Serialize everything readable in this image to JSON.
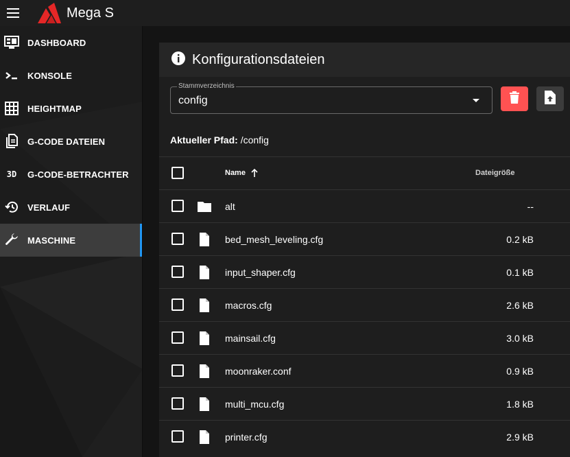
{
  "app": {
    "title": "Mega S"
  },
  "sidebar": {
    "items": [
      {
        "label": "DASHBOARD",
        "icon": "monitor-dashboard-icon",
        "active": false
      },
      {
        "label": "KONSOLE",
        "icon": "console-icon",
        "active": false
      },
      {
        "label": "HEIGHTMAP",
        "icon": "grid-icon",
        "active": false
      },
      {
        "label": "G-CODE DATEIEN",
        "icon": "file-document-multiple-icon",
        "active": false
      },
      {
        "label": "G-CODE-BETRACHTER",
        "icon": "3d-icon",
        "active": false
      },
      {
        "label": "VERLAUF",
        "icon": "history-icon",
        "active": false
      },
      {
        "label": "MASCHINE",
        "icon": "wrench-icon",
        "active": true
      }
    ],
    "icon_3d_text": "3D"
  },
  "main": {
    "title": "Konfigurationsdateien",
    "root_select": {
      "label": "Stammverzeichnis",
      "value": "config"
    },
    "path": {
      "label": "Aktueller Pfad:",
      "value": "/config"
    },
    "table": {
      "headers": {
        "name": "Name",
        "size": "Dateigröße"
      },
      "rows": [
        {
          "name": "alt",
          "type": "folder",
          "size": "--"
        },
        {
          "name": "bed_mesh_leveling.cfg",
          "type": "file",
          "size": "0.2 kB"
        },
        {
          "name": "input_shaper.cfg",
          "type": "file",
          "size": "0.1 kB"
        },
        {
          "name": "macros.cfg",
          "type": "file",
          "size": "2.6 kB"
        },
        {
          "name": "mainsail.cfg",
          "type": "file",
          "size": "3.0 kB"
        },
        {
          "name": "moonraker.conf",
          "type": "file",
          "size": "0.9 kB"
        },
        {
          "name": "multi_mcu.cfg",
          "type": "file",
          "size": "1.8 kB"
        },
        {
          "name": "printer.cfg",
          "type": "file",
          "size": "2.9 kB"
        }
      ]
    }
  },
  "colors": {
    "accent": "#2196f3",
    "delete": "#ff5252",
    "logo": "#e52727"
  }
}
